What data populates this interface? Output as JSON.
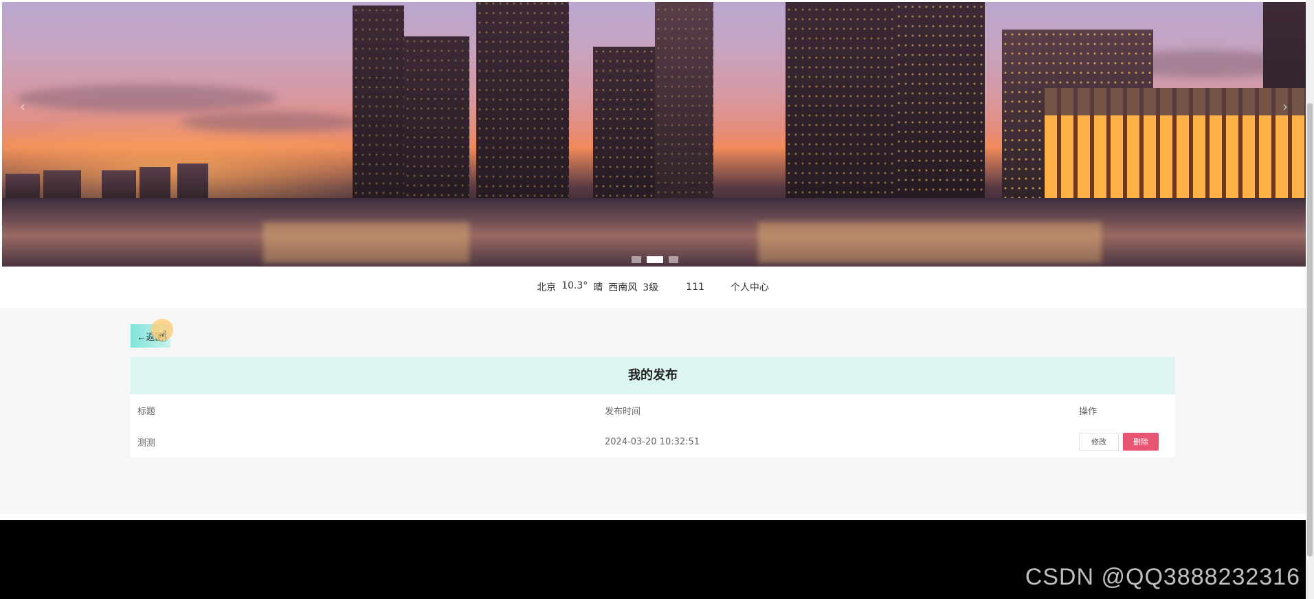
{
  "banner": {
    "alt": "city skyline at sunset"
  },
  "infobar": {
    "city": "北京",
    "temp": "10.3°",
    "weather": "晴",
    "wind": "西南风",
    "level": "3级",
    "count": "111",
    "user_center": "个人中心"
  },
  "main": {
    "back_label": "←返回",
    "panel_title": "我的发布",
    "table": {
      "headers": [
        "标题",
        "发布时间",
        "操作"
      ],
      "rows": [
        {
          "title": "测测",
          "time": "2024-03-20 10:32:51",
          "edit": "修改",
          "delete": "删除"
        }
      ]
    }
  },
  "footer": {
    "watermark": "CSDN @QQ3888232316"
  },
  "colors": {
    "panel_bg": "#dcf5f1",
    "delete": "#e85573",
    "accent": "#7ee3d8"
  }
}
